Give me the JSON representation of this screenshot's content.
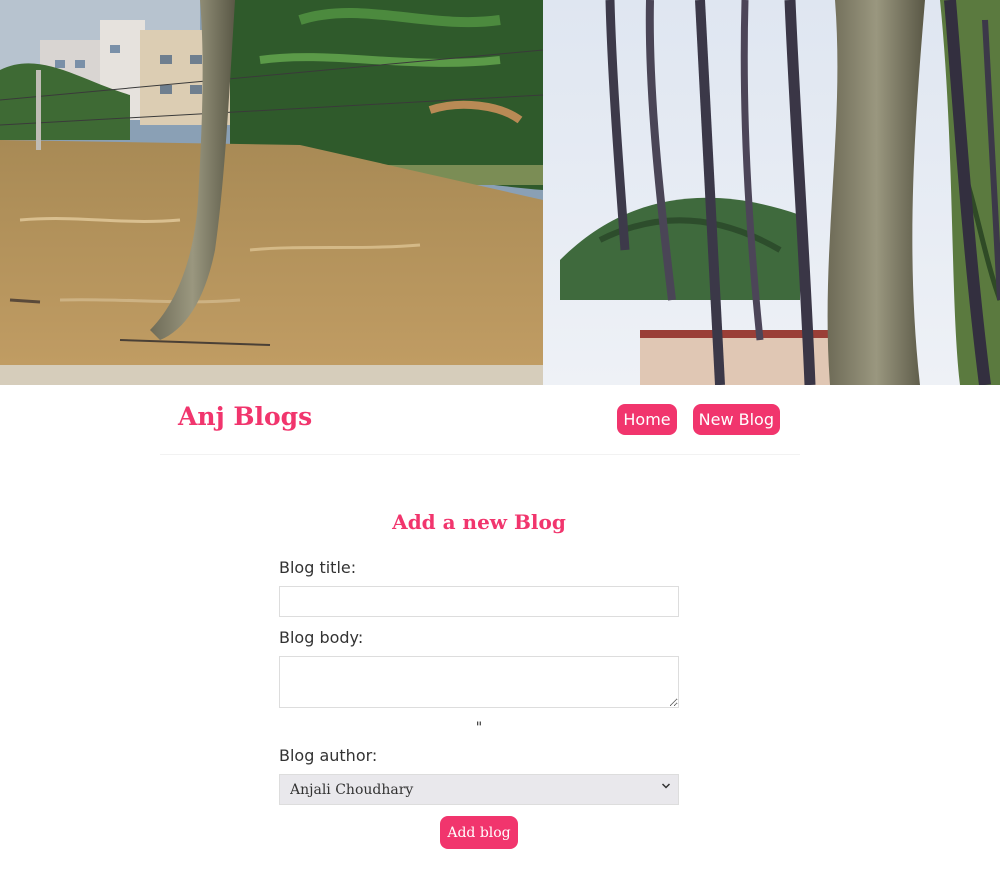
{
  "hero": {
    "image_label": "flooded street with palm trees"
  },
  "navbar": {
    "brand": "Anj Blogs",
    "links": [
      {
        "label": "Home"
      },
      {
        "label": "New Blog"
      }
    ]
  },
  "create": {
    "heading": "Add a new Blog",
    "title_label": "Blog title:",
    "title_value": "",
    "body_label": "Blog body:",
    "body_value": "",
    "stray_text": "\"",
    "author_label": "Blog author:",
    "author_selected": "Anjali Choudhary",
    "submit_label": "Add blog"
  },
  "colors": {
    "accent": "#f1356d",
    "text": "#333333",
    "border": "#dddddd"
  }
}
